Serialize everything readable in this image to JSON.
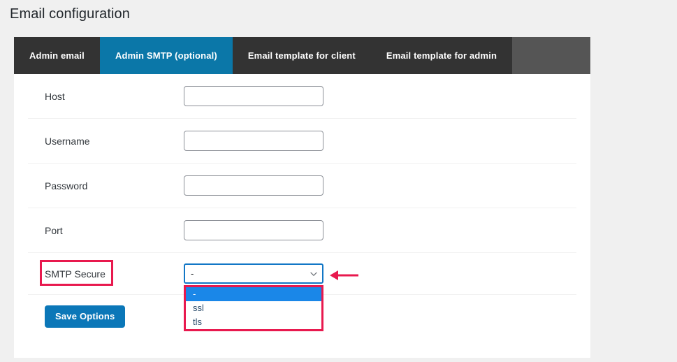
{
  "page": {
    "title": "Email configuration"
  },
  "tabs": [
    {
      "label": "Admin email",
      "active": false
    },
    {
      "label": "Admin SMTP (optional)",
      "active": true
    },
    {
      "label": "Email template for client",
      "active": false
    },
    {
      "label": "Email template for admin",
      "active": false
    }
  ],
  "form": {
    "fields": [
      {
        "label": "Host",
        "value": "",
        "placeholder": ""
      },
      {
        "label": "Username",
        "value": "",
        "placeholder": ""
      },
      {
        "label": "Password",
        "value": "",
        "placeholder": ""
      },
      {
        "label": "Port",
        "value": "",
        "placeholder": ""
      }
    ],
    "smtp_secure": {
      "label": "SMTP Secure",
      "selected": "-",
      "options": [
        "-",
        "ssl",
        "tls"
      ],
      "chevron_icon": "chevron-down-icon",
      "expanded": true
    },
    "save_label": "Save Options"
  },
  "annotations": {
    "label_highlight_color": "#e8194e",
    "dropdown_highlight_color": "#e8194e",
    "arrow_color": "#e8194e",
    "arrow_icon": "arrow-left-icon"
  },
  "colors": {
    "page_background": "#f0f0f0",
    "card_background": "#ffffff",
    "tab_inactive": "#333333",
    "tab_strip_filler": "#555555",
    "tab_active": "#0b77a8",
    "button_blue": "#0b77b8",
    "option_highlight": "#1a87e8",
    "select_focus_border": "#1277c6",
    "title_text": "#23282d"
  }
}
